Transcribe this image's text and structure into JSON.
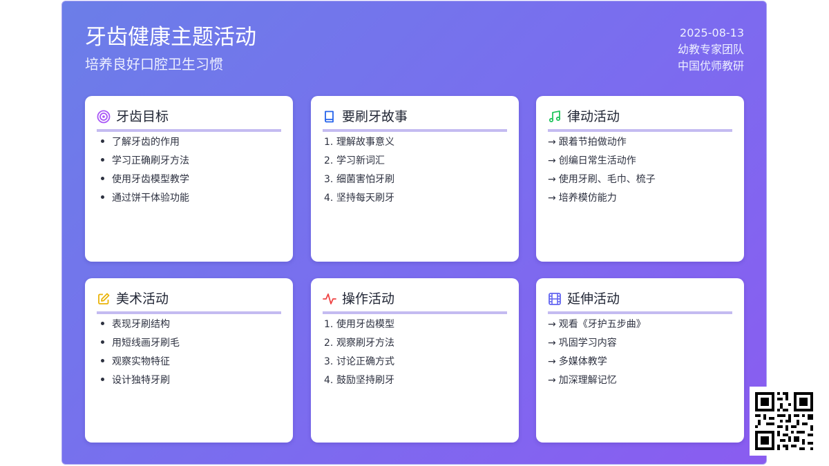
{
  "header": {
    "title": "牙齿健康主题活动",
    "subtitle": "培养良好口腔卫生习惯",
    "date": "2025-08-13",
    "team": "幼教专家团队",
    "org": "中国优师教研"
  },
  "cards": [
    {
      "title": "牙齿目标",
      "icon": "target-icon",
      "style": "bullet",
      "items": [
        "了解牙齿的作用",
        "学习正确刷牙方法",
        "使用牙齿模型教学",
        "通过饼干体验功能"
      ]
    },
    {
      "title": "要刷牙故事",
      "icon": "book-icon",
      "style": "numbered",
      "items": [
        "理解故事意义",
        "学习新词汇",
        "细菌害怕牙刷",
        "坚持每天刷牙"
      ]
    },
    {
      "title": "律动活动",
      "icon": "music-note-icon",
      "style": "arrow",
      "items": [
        "跟着节拍做动作",
        "创编日常生活动作",
        "使用牙刷、毛巾、梳子",
        "培养模仿能力"
      ]
    },
    {
      "title": "美术活动",
      "icon": "edit-icon",
      "style": "bullet",
      "items": [
        "表现牙刷结构",
        "用短线画牙刷毛",
        "观察实物特征",
        "设计独特牙刷"
      ]
    },
    {
      "title": "操作活动",
      "icon": "activity-pulse-icon",
      "style": "numbered",
      "items": [
        "使用牙齿模型",
        "观察刷牙方法",
        "讨论正确方式",
        "鼓励坚持刷牙"
      ]
    },
    {
      "title": "延伸活动",
      "icon": "film-icon",
      "style": "arrow",
      "items": [
        "观看《牙护五步曲》",
        "巩固学习内容",
        "多媒体教学",
        "加深理解记忆"
      ]
    }
  ],
  "colors": {
    "gradient_start": "#6b7ee8",
    "gradient_end": "#8a5cf0",
    "card_underline": "#c4bbf1",
    "icon_target": "#a855f7",
    "icon_book": "#2563eb",
    "icon_music": "#22c55e",
    "icon_edit": "#eab308",
    "icon_activity": "#ef4444",
    "icon_film": "#6366f1"
  },
  "qr_code": {
    "icon": "qr-code-icon"
  }
}
